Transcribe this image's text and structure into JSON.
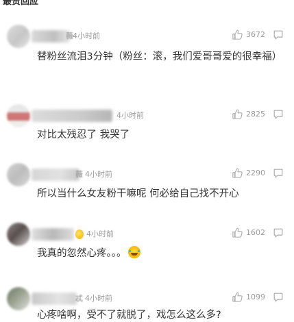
{
  "section": {
    "title": "最赞回应"
  },
  "comments": [
    {
      "name_char": "薇",
      "time": "4小时前",
      "likes": "3672",
      "text": "替粉丝流泪3分钟（粉丝：滚，我们爱哥哥爱的很幸福）"
    },
    {
      "name_char": "",
      "time": "4小时前",
      "likes": "2825",
      "text": "对比太残忍了 我哭了"
    },
    {
      "name_char": "薇",
      "time": "4小时前",
      "likes": "2290",
      "text": "所以当什么女友粉干嘛呢 何必给自己找不开心"
    },
    {
      "name_char": "",
      "time": "4小时前",
      "likes": "1602",
      "text": "我真的忽然心疼。。。",
      "emoji": "laughing-tears-emoji"
    },
    {
      "name_char": "忒",
      "time": "4小时前",
      "likes": "1099",
      "text": "心疼啥啊，受不了就脱了，戏怎么这么多?"
    }
  ],
  "icons": {
    "like": "thumbs-up-icon",
    "reply": "comment-icon"
  },
  "colors": {
    "text": "#333333",
    "meta": "#999999"
  }
}
